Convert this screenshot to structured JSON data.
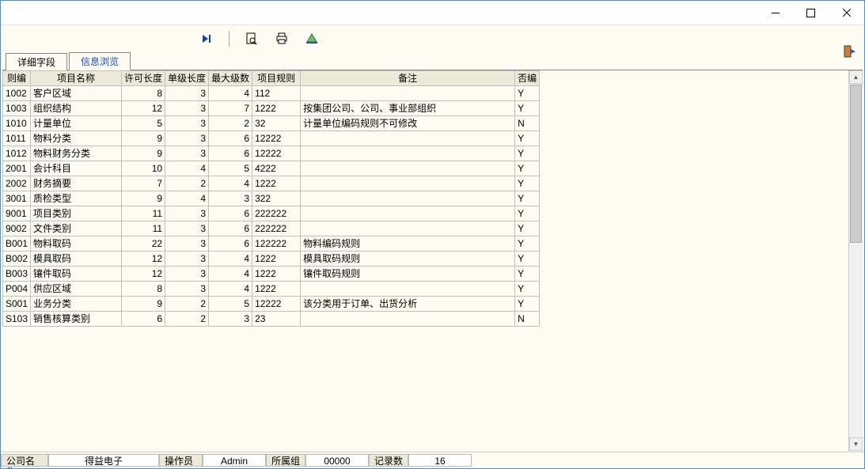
{
  "tabs": {
    "detail": "详细字段",
    "browse": "信息浏览"
  },
  "columns": {
    "code": "则编",
    "name": "项目名称",
    "len": "许可长度",
    "unitlen": "单级长度",
    "maxlvl": "最大级数",
    "rule": "项目规则",
    "remark": "备注",
    "editable": "否编"
  },
  "rows": [
    {
      "code": "1002",
      "name": "客户区域",
      "len": "8",
      "unitlen": "3",
      "maxlvl": "4",
      "rule": "112",
      "remark": "",
      "editable": "Y"
    },
    {
      "code": "1003",
      "name": "组织结构",
      "len": "12",
      "unitlen": "3",
      "maxlvl": "7",
      "rule": "1222",
      "remark": "按集团公司、公司、事业部组织",
      "editable": "Y"
    },
    {
      "code": "1010",
      "name": "计量单位",
      "len": "5",
      "unitlen": "3",
      "maxlvl": "2",
      "rule": "32",
      "remark": "计量单位编码规则不可修改",
      "editable": "N"
    },
    {
      "code": "1011",
      "name": "物料分类",
      "len": "9",
      "unitlen": "3",
      "maxlvl": "6",
      "rule": "12222",
      "remark": "",
      "editable": "Y"
    },
    {
      "code": "1012",
      "name": "物料财务分类",
      "len": "9",
      "unitlen": "3",
      "maxlvl": "6",
      "rule": "12222",
      "remark": "",
      "editable": "Y"
    },
    {
      "code": "2001",
      "name": "会计科目",
      "len": "10",
      "unitlen": "4",
      "maxlvl": "5",
      "rule": "4222",
      "remark": "",
      "editable": "Y"
    },
    {
      "code": "2002",
      "name": "财务摘要",
      "len": "7",
      "unitlen": "2",
      "maxlvl": "4",
      "rule": "1222",
      "remark": "",
      "editable": "Y"
    },
    {
      "code": "3001",
      "name": "质检类型",
      "len": "9",
      "unitlen": "4",
      "maxlvl": "3",
      "rule": "322",
      "remark": "",
      "editable": "Y"
    },
    {
      "code": "9001",
      "name": "项目类别",
      "len": "11",
      "unitlen": "3",
      "maxlvl": "6",
      "rule": "222222",
      "remark": "",
      "editable": "Y"
    },
    {
      "code": "9002",
      "name": "文件类别",
      "len": "11",
      "unitlen": "3",
      "maxlvl": "6",
      "rule": "222222",
      "remark": "",
      "editable": "Y"
    },
    {
      "code": "B001",
      "name": "物料取码",
      "len": "22",
      "unitlen": "3",
      "maxlvl": "6",
      "rule": "122222",
      "remark": "物料编码规则",
      "editable": "Y"
    },
    {
      "code": "B002",
      "name": "模具取码",
      "len": "12",
      "unitlen": "3",
      "maxlvl": "4",
      "rule": "1222",
      "remark": "模具取码规则",
      "editable": "Y"
    },
    {
      "code": "B003",
      "name": "镶件取码",
      "len": "12",
      "unitlen": "3",
      "maxlvl": "4",
      "rule": "1222",
      "remark": "镶件取码规则",
      "editable": "Y"
    },
    {
      "code": "P004",
      "name": "供应区域",
      "len": "8",
      "unitlen": "3",
      "maxlvl": "4",
      "rule": "1222",
      "remark": "",
      "editable": "Y"
    },
    {
      "code": "S001",
      "name": "业务分类",
      "len": "9",
      "unitlen": "2",
      "maxlvl": "5",
      "rule": "12222",
      "remark": "该分类用于订单、出货分析",
      "editable": "Y"
    },
    {
      "code": "S103",
      "name": "销售核算类别",
      "len": "6",
      "unitlen": "2",
      "maxlvl": "3",
      "rule": "23",
      "remark": "",
      "editable": "N"
    }
  ],
  "status": {
    "company_label": "公司名称",
    "company_value": "得益电子",
    "operator_label": "操作员",
    "operator_value": "Admin",
    "group_label": "所属组",
    "group_value": "00000",
    "count_label": "记录数",
    "count_value": "16"
  }
}
